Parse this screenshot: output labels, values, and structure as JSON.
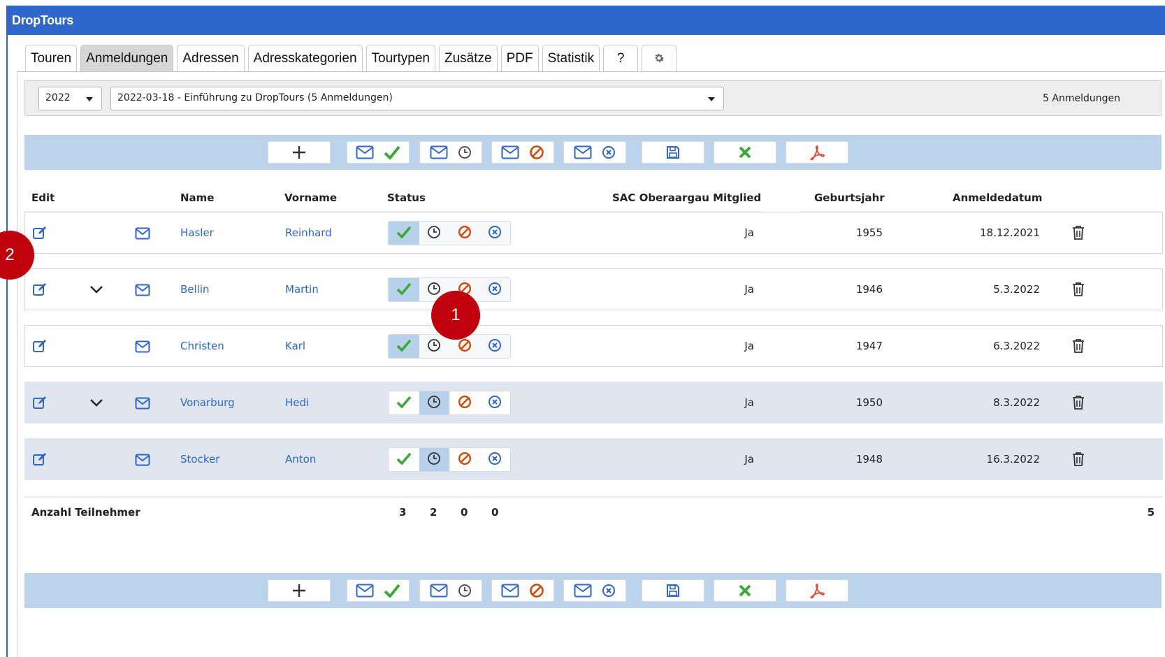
{
  "app": {
    "title": "DropTours"
  },
  "tabs": [
    {
      "label": "Touren",
      "active": false
    },
    {
      "label": "Anmeldungen",
      "active": true
    },
    {
      "label": "Adressen",
      "active": false
    },
    {
      "label": "Adresskategorien",
      "active": false
    },
    {
      "label": "Tourtypen",
      "active": false
    },
    {
      "label": "Zusätze",
      "active": false
    },
    {
      "label": "PDF",
      "active": false
    },
    {
      "label": "Statistik",
      "active": false
    },
    {
      "label": "?",
      "active": false
    },
    {
      "label": "",
      "icon": "gear-icon",
      "active": false
    }
  ],
  "filter": {
    "year": "2022",
    "tour": "2022-03-18 - Einführung zu DropTours (5 Anmeldungen)",
    "count_label": "5 Anmeldungen"
  },
  "toolbar_icons": [
    "plus-icon",
    "mail-check-icon",
    "mail-clock-icon",
    "mail-cancel-icon",
    "mail-x-icon",
    "save-icon",
    "x-icon",
    "pdf-icon"
  ],
  "table": {
    "headers": {
      "edit": "Edit",
      "name": "Name",
      "vorname": "Vorname",
      "status": "Status",
      "mitglied": "SAC Oberaargau Mitglied",
      "geburtsjahr": "Geburtsjahr",
      "anmeldedatum": "Anmeldedatum"
    },
    "rows": [
      {
        "name": "Hasler",
        "vorname": "Reinhard",
        "status": "confirmed",
        "has_expander": false,
        "mitglied": "Ja",
        "geburtsjahr": "1955",
        "anmeldedatum": "18.12.2021"
      },
      {
        "name": "Bellin",
        "vorname": "Martin",
        "status": "confirmed",
        "has_expander": true,
        "mitglied": "Ja",
        "geburtsjahr": "1946",
        "anmeldedatum": "5.3.2022"
      },
      {
        "name": "Christen",
        "vorname": "Karl",
        "status": "confirmed",
        "has_expander": false,
        "mitglied": "Ja",
        "geburtsjahr": "1947",
        "anmeldedatum": "6.3.2022"
      },
      {
        "name": "Vonarburg",
        "vorname": "Hedi",
        "status": "waiting",
        "has_expander": true,
        "mitglied": "Ja",
        "geburtsjahr": "1950",
        "anmeldedatum": "8.3.2022"
      },
      {
        "name": "Stocker",
        "vorname": "Anton",
        "status": "waiting",
        "has_expander": false,
        "mitglied": "Ja",
        "geburtsjahr": "1948",
        "anmeldedatum": "16.3.2022"
      }
    ],
    "footer": {
      "label": "Anzahl Teilnehmer",
      "confirmed": "3",
      "waiting": "2",
      "declined": "0",
      "cancelled": "0",
      "total": "5"
    }
  },
  "annotations": [
    {
      "label": "1"
    },
    {
      "label": "2"
    }
  ],
  "colors": {
    "brand": "#2f66cc",
    "toolbar": "#bcd4eb",
    "check": "#3aaa35",
    "decline": "#d04a0a",
    "cancel": "#2f66cc",
    "badge": "#c0000a"
  }
}
